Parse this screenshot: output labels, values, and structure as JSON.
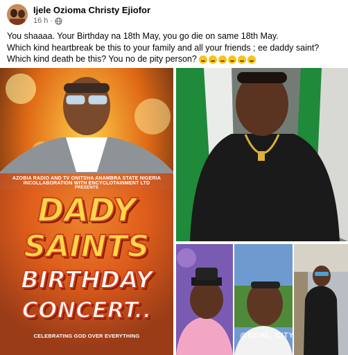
{
  "post": {
    "author": "Ijele Ozioma Christy Ejiofor",
    "time": "16 h",
    "separator": "·",
    "privacy_icon": "globe-icon",
    "caption_lines": [
      "You shaaaa. Your Birthday na 18th May, you go die on same 18th May.",
      "Which kind heartbreak be this to your family and all your friends ; ee daddy saint?",
      "Which kind death be this? You no de pity person?"
    ],
    "caption_emoji_icons": [
      "disappointed-face-icon",
      "crying-face-icon",
      "crying-face-icon",
      "crying-face-icon",
      "crying-face-icon",
      "crying-face-icon"
    ]
  },
  "flyer": {
    "line1": "AZOBIA RADIO AND TV ONITSHA ANAMBRA STATE NIGERIA",
    "line2": "INCOLLABORATION WITH ENCYCLOTAINMENT LTD",
    "line3": "PRESENTS",
    "title1": "DADY",
    "title2": "SAINTS",
    "title3": "BIRTHDAY",
    "title4": "CONCERT..",
    "tagline": "CELEBRATING GOD OVER EVERYTHING"
  },
  "watermark": "@COAL_CITY",
  "colors": {
    "flyer_orange": "#e0551f",
    "flyer_yellow": "#f2b61c",
    "flag_green": "#1f8a3a"
  }
}
